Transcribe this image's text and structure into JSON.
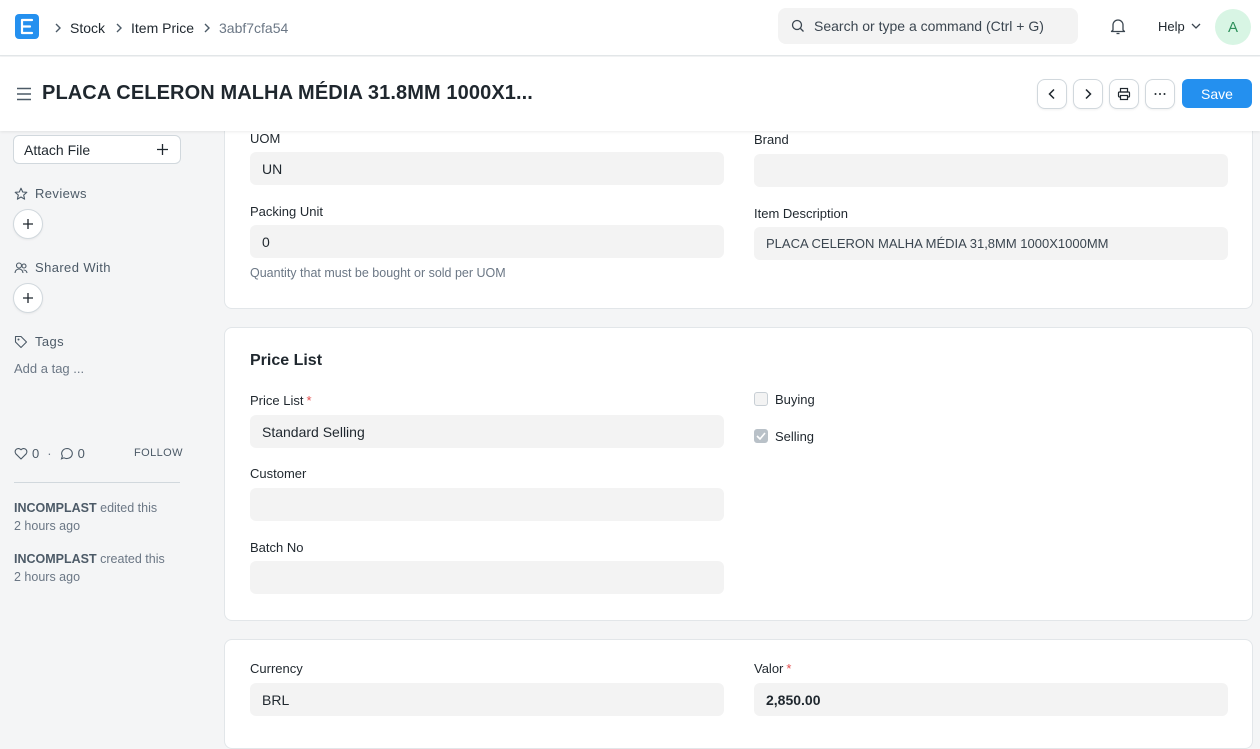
{
  "navbar": {
    "breadcrumbs": [
      "Stock",
      "Item Price",
      "3abf7cfa54"
    ],
    "search_placeholder": "Search or type a command (Ctrl + G)",
    "help_label": "Help",
    "avatar_initial": "A"
  },
  "page": {
    "title": "PLACA CELERON MALHA MÉDIA 31.8MM 1000X1...",
    "save_label": "Save"
  },
  "sidebar": {
    "attach_file_label": "Attach File",
    "reviews_label": "Reviews",
    "shared_with_label": "Shared With",
    "tags_label": "Tags",
    "add_tag_placeholder": "Add a tag ...",
    "likes_count": "0",
    "comments_count": "0",
    "follow_label": "FOLLOW",
    "timeline": [
      {
        "user": "INCOMPLAST",
        "action": "edited this",
        "time": "2 hours ago"
      },
      {
        "user": "INCOMPLAST",
        "action": "created this",
        "time": "2 hours ago"
      }
    ]
  },
  "item_card": {
    "uom_label": "UOM",
    "uom_value": "UN",
    "brand_label": "Brand",
    "brand_value": "",
    "packing_unit_label": "Packing Unit",
    "packing_unit_value": "0",
    "packing_unit_help": "Quantity that must be bought or sold per UOM",
    "item_description_label": "Item Description",
    "item_description_value": "PLACA CELERON MALHA MÉDIA 31,8MM 1000X1000MM"
  },
  "price_list_card": {
    "section_title": "Price List",
    "price_list_label": "Price List",
    "price_list_value": "Standard Selling",
    "customer_label": "Customer",
    "customer_value": "",
    "batch_no_label": "Batch No",
    "batch_no_value": "",
    "buying_label": "Buying",
    "buying_checked": false,
    "selling_label": "Selling",
    "selling_checked": true
  },
  "currency_card": {
    "currency_label": "Currency",
    "currency_value": "BRL",
    "valor_label": "Valor",
    "valor_value": "2,850.00"
  },
  "colors": {
    "primary": "#2490ef",
    "required": "#e24c4c",
    "input_bg": "#f3f3f3"
  }
}
